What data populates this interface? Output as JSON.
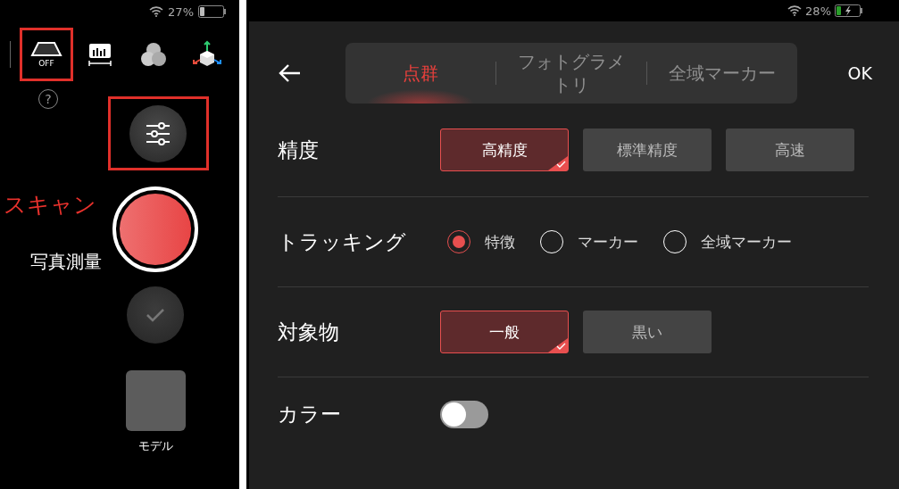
{
  "left_screen": {
    "status_bar": {
      "battery": "27%"
    },
    "toolbar": [
      {
        "kind": "projector",
        "label": "OFF",
        "highlighted": true
      },
      {
        "kind": "ruler",
        "highlighted": false
      },
      {
        "kind": "circles",
        "highlighted": false
      },
      {
        "kind": "axes",
        "highlighted": false
      }
    ],
    "help_label": "?",
    "settings_highlighted": true,
    "modes": [
      {
        "label": "スキャン",
        "selected": true
      },
      {
        "label": "写真測量",
        "selected": false
      }
    ],
    "model_label": "モデル"
  },
  "right_screen": {
    "status_bar": {
      "battery": "28%",
      "charging": true
    },
    "tabs": [
      {
        "label": "点群",
        "selected": true
      },
      {
        "label": "フォトグラメトリ",
        "selected": false
      },
      {
        "label": "全域マーカー",
        "selected": false
      }
    ],
    "ok": "OK",
    "settings": [
      {
        "kind": "choice",
        "label": "精度",
        "options": [
          {
            "label": "高精度",
            "selected": true
          },
          {
            "label": "標準精度",
            "selected": false
          },
          {
            "label": "高速",
            "selected": false
          }
        ]
      },
      {
        "kind": "radio",
        "label": "トラッキング",
        "options": [
          {
            "label": "特徴",
            "selected": true
          },
          {
            "label": "マーカー",
            "selected": false
          },
          {
            "label": "全域マーカー",
            "selected": false
          }
        ]
      },
      {
        "kind": "choice",
        "label": "対象物",
        "options": [
          {
            "label": "一般",
            "selected": true
          },
          {
            "label": "黒い",
            "selected": false
          }
        ]
      },
      {
        "kind": "toggle",
        "label": "カラー",
        "on": false
      }
    ]
  }
}
